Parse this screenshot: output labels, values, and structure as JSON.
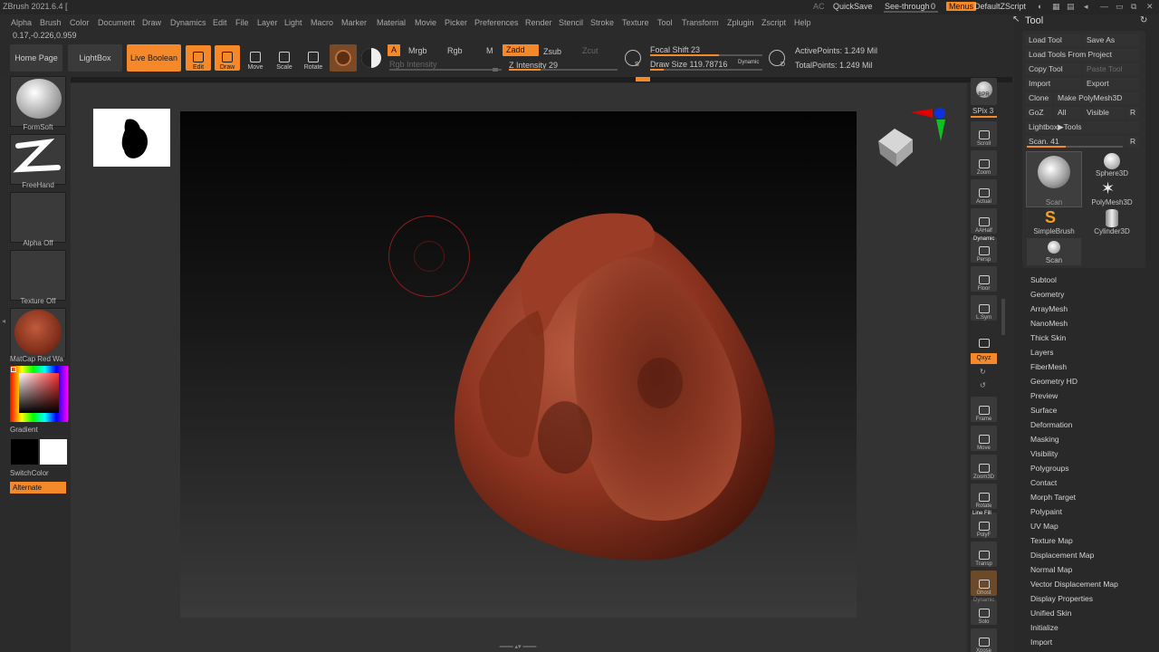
{
  "titlebar": {
    "app_title": "ZBrush 2021.6.4 [",
    "menus": [
      "Alpha",
      "Brush",
      "Color",
      "Document",
      "Draw",
      "Dynamics",
      "Edit",
      "File",
      "Layer",
      "Light",
      "Macro",
      "Marker",
      "Material",
      "Movie",
      "Picker",
      "Preferences",
      "Render",
      "Stencil",
      "Stroke",
      "Texture",
      "Tool",
      "Transform",
      "Zplugin",
      "Zscript",
      "Help"
    ],
    "ac": "AC",
    "quicksave": "QuickSave",
    "see_through_label": "See-through",
    "see_through_value": "0",
    "menus_btn": "Menus",
    "zscript": "DefaultZScript"
  },
  "coords": "0.17,-0.226,0.959",
  "toolbar": {
    "home_page": "Home Page",
    "lightbox": "LightBox",
    "live_boolean": "Live Boolean",
    "edit": "Edit",
    "draw": "Draw",
    "move": "Move",
    "scale": "Scale",
    "rotate": "Rotate",
    "a_chip": "A",
    "mrgb": "Mrgb",
    "rgb": "Rgb",
    "m": "M",
    "zadd": "Zadd",
    "zsub": "Zsub",
    "zcut": "Zcut",
    "rgb_intensity": "Rgb Intensity",
    "z_intensity_label": "Z Intensity",
    "z_intensity_value": "29",
    "focal_shift_label": "Focal Shift",
    "focal_shift_value": "23",
    "draw_size_label": "Draw Size",
    "draw_size_value": "119.78716",
    "dynamic": "Dynamic",
    "s_letter": "S",
    "d_letter": "D",
    "active_points": "ActivePoints: 1.249 Mil",
    "total_points": "TotalPoints: 1.249 Mil"
  },
  "left_shelf": {
    "brush": "FormSoft",
    "stroke": "FreeHand",
    "alpha": "Alpha Off",
    "texture": "Texture Off",
    "material": "MatCap Red Wa",
    "gradient": "Gradient",
    "switch_color": "SwitchColor",
    "alternate": "Alternate"
  },
  "right_shelf": {
    "bpr": "BPR",
    "spix_label": "SPix",
    "spix_value": "3",
    "buttons": [
      "Scroll",
      "Zoom",
      "Actual",
      "AAHalf",
      "Persp",
      "Floor",
      "L.Sym",
      "",
      "Frame",
      "Move",
      "Zoom3D",
      "Rotate",
      "PolyF",
      "Transp",
      "Ghost",
      "Solo",
      "Xpose"
    ],
    "dynamic": "Dynamic",
    "line_fill": "Line Fill",
    "xyz": "Qxyz",
    "dynamic2": "Dynamic"
  },
  "tool_palette": {
    "title": "Tool",
    "load_tool": "Load Tool",
    "save_as": "Save As",
    "load_from_project": "Load Tools From Project",
    "copy_tool": "Copy Tool",
    "paste_tool": "Paste Tool",
    "import": "Import",
    "export": "Export",
    "clone": "Clone",
    "make_polymesh": "Make PolyMesh3D",
    "goz": "GoZ",
    "all": "All",
    "visible": "Visible",
    "r": "R",
    "lightbox_tools": "Lightbox▶Tools",
    "scan_label": "Scan.",
    "scan_value": "41",
    "tools": [
      "Scan",
      "Sphere3D",
      "PolyMesh3D",
      "SimpleBrush",
      "Cylinder3D",
      "Scan"
    ],
    "subpalettes": [
      "Subtool",
      "Geometry",
      "ArrayMesh",
      "NanoMesh",
      "Thick Skin",
      "Layers",
      "FiberMesh",
      "Geometry HD",
      "Preview",
      "Surface",
      "Deformation",
      "Masking",
      "Visibility",
      "Polygroups",
      "Contact",
      "Morph Target",
      "Polypaint",
      "UV Map",
      "Texture Map",
      "Displacement Map",
      "Normal Map",
      "Vector Displacement Map",
      "Display Properties",
      "Unified Skin",
      "Initialize",
      "Import"
    ]
  },
  "colors": {
    "accent": "#f5892a",
    "model": "#9a3a22"
  },
  "sliders": {
    "z_intensity": 0.29,
    "focal_shift": 0.61,
    "draw_size": 0.12,
    "scan": 0.41
  }
}
